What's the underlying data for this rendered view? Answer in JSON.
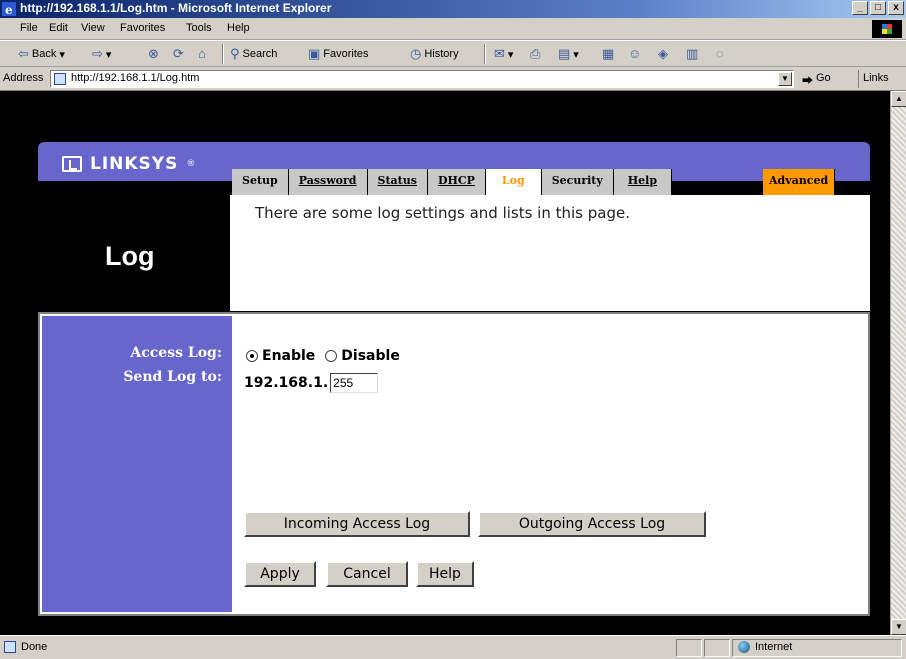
{
  "window": {
    "title": "http://192.168.1.1/Log.htm - Microsoft Internet Explorer",
    "minimize": "_",
    "restore": "□",
    "close": "x"
  },
  "menu": [
    "File",
    "Edit",
    "View",
    "Favorites",
    "Tools",
    "Help"
  ],
  "toolbar": {
    "back": "Back",
    "search": "Search",
    "favorites": "Favorites",
    "history": "History"
  },
  "address": {
    "label": "Address",
    "url": "http://192.168.1.1/Log.htm",
    "go": "Go",
    "links": "Links"
  },
  "brand": {
    "name": "LINKSYS",
    "reg": "®"
  },
  "tabs": [
    {
      "label": "Setup",
      "state": "plain"
    },
    {
      "label": "Password",
      "state": "link"
    },
    {
      "label": "Status",
      "state": "link"
    },
    {
      "label": "DHCP",
      "state": "link"
    },
    {
      "label": "Log",
      "state": "active"
    },
    {
      "label": "Security",
      "state": "plain"
    },
    {
      "label": "Help",
      "state": "link"
    }
  ],
  "advanced_tab": "Advanced",
  "page": {
    "title": "Log",
    "intro": "There are some log settings and lists in this page."
  },
  "form": {
    "access_log_label": "Access Log:",
    "enable_label": "Enable",
    "disable_label": "Disable",
    "access_log_value": "Enable",
    "send_log_label": "Send Log to:",
    "ip_prefix": "192.168.1.",
    "ip_last_octet": "255"
  },
  "buttons": {
    "incoming": "Incoming Access Log",
    "outgoing": "Outgoing Access Log",
    "apply": "Apply",
    "cancel": "Cancel",
    "help": "Help"
  },
  "status": {
    "text": "Done",
    "zone": "Internet"
  },
  "colors": {
    "brand_purple": "#6666cc",
    "active_tab": "#ff9900",
    "advanced_tab": "#ff9900"
  }
}
